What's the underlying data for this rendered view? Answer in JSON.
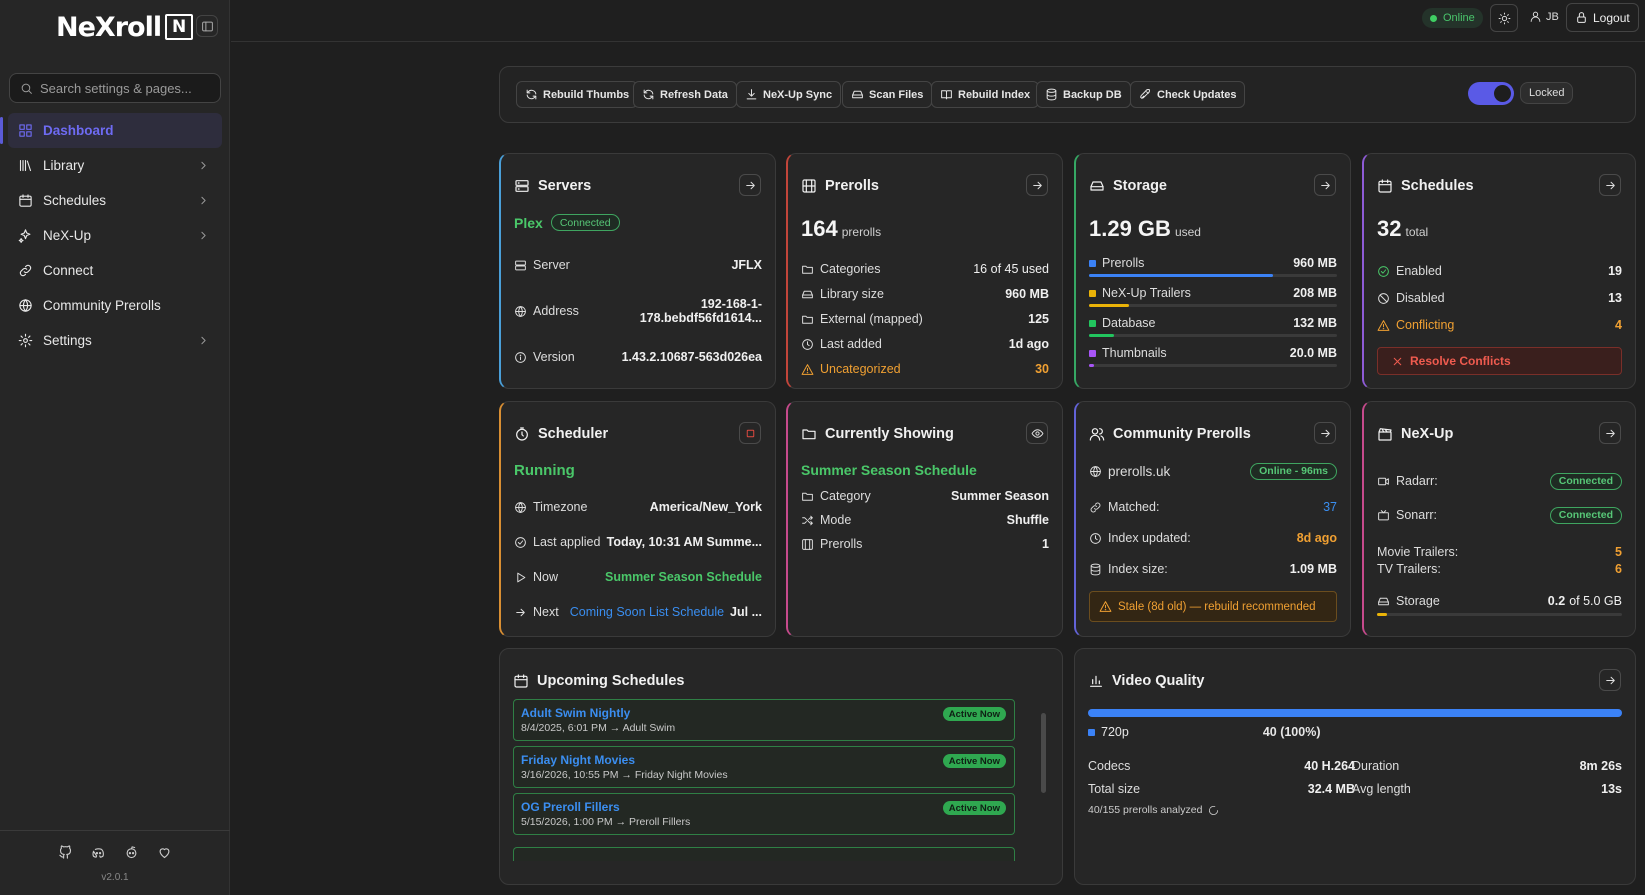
{
  "app": {
    "logo_text": "NeXroll",
    "logo_mark": "N",
    "version": "v2.0.1"
  },
  "search": {
    "placeholder": "Search settings & pages..."
  },
  "sidebar": {
    "items": [
      {
        "label": "Dashboard",
        "icon": "dashboard-icon",
        "active": true
      },
      {
        "label": "Library",
        "icon": "library-icon",
        "chevron": true
      },
      {
        "label": "Schedules",
        "icon": "calendar-icon",
        "chevron": true
      },
      {
        "label": "NeX-Up",
        "icon": "sparkles-icon",
        "chevron": true
      },
      {
        "label": "Connect",
        "icon": "link-icon"
      },
      {
        "label": "Community Prerolls",
        "icon": "globe-icon"
      },
      {
        "label": "Settings",
        "icon": "gear-icon",
        "chevron": true
      }
    ],
    "footer_icons": [
      "github-icon",
      "discord-icon",
      "reddit-icon",
      "heart-icon"
    ]
  },
  "topbar": {
    "status": "Online",
    "user": "JB",
    "logout": "Logout"
  },
  "toolbar": {
    "buttons": [
      "Rebuild Thumbs",
      "Refresh Data",
      "NeX-Up Sync",
      "Scan Files",
      "Rebuild Index",
      "Backup DB",
      "Check Updates"
    ],
    "lock_label": "Locked"
  },
  "servers": {
    "title": "Servers",
    "provider": "Plex",
    "status": "Connected",
    "server_label": "Server",
    "server_value": "JFLX",
    "address_label": "Address",
    "address_value": "192-168-1-178.bebdf56fd1614...",
    "version_label": "Version",
    "version_value": "1.43.2.10687-563d026ea"
  },
  "prerolls": {
    "title": "Prerolls",
    "count": "164",
    "count_unit": "prerolls",
    "rows": [
      {
        "label": "Categories",
        "value": "16 of 45 used"
      },
      {
        "label": "Library size",
        "value": "960 MB"
      },
      {
        "label": "External (mapped)",
        "value": "125"
      },
      {
        "label": "Last added",
        "value": "1d ago"
      },
      {
        "label": "Uncategorized",
        "value": "30"
      }
    ]
  },
  "storage": {
    "title": "Storage",
    "used": "1.29 GB",
    "used_unit": "used",
    "rows": [
      {
        "label": "Prerolls",
        "value": "960 MB",
        "color": "#3b82f6",
        "fraction": 0.74
      },
      {
        "label": "NeX-Up Trailers",
        "value": "208 MB",
        "color": "#eab308",
        "fraction": 0.16
      },
      {
        "label": "Database",
        "value": "132 MB",
        "color": "#22c55e",
        "fraction": 0.1
      },
      {
        "label": "Thumbnails",
        "value": "20.0 MB",
        "color": "#a855f7",
        "fraction": 0.02
      }
    ]
  },
  "schedules": {
    "title": "Schedules",
    "count": "32",
    "count_unit": "total",
    "enabled_label": "Enabled",
    "enabled_value": "19",
    "disabled_label": "Disabled",
    "disabled_value": "13",
    "conflicting_label": "Conflicting",
    "conflicting_value": "4",
    "resolve_label": "Resolve Conflicts"
  },
  "scheduler": {
    "title": "Scheduler",
    "status": "Running",
    "timezone_label": "Timezone",
    "timezone_value": "America/New_York",
    "last_label": "Last applied",
    "last_value": "Today, 10:31 AM Summe...",
    "now_label": "Now",
    "now_value": "Summer Season Schedule",
    "next_label": "Next",
    "next_value": "Coming Soon List Schedule",
    "next_suffix": "Jul ..."
  },
  "current": {
    "title": "Currently Showing",
    "schedule": "Summer Season Schedule",
    "category_label": "Category",
    "category_value": "Summer Season",
    "mode_label": "Mode",
    "mode_value": "Shuffle",
    "prerolls_label": "Prerolls",
    "prerolls_value": "1"
  },
  "community": {
    "title": "Community Prerolls",
    "site": "prerolls.uk",
    "status": "Online - 96ms",
    "matched_label": "Matched:",
    "matched_value": "37",
    "updated_label": "Index updated:",
    "updated_value": "8d ago",
    "size_label": "Index size:",
    "size_value": "1.09 MB",
    "warning": "Stale (8d old) — rebuild recommended"
  },
  "nexup": {
    "title": "NeX-Up",
    "radarr_label": "Radarr:",
    "radarr_status": "Connected",
    "sonarr_label": "Sonarr:",
    "sonarr_status": "Connected",
    "movie_label": "Movie Trailers:",
    "movie_value": "5",
    "tv_label": "TV Trailers:",
    "tv_value": "6",
    "storage_label": "Storage",
    "storage_used": "0.2",
    "storage_of": "of 5.0 GB",
    "storage_fraction": 0.04
  },
  "upcoming": {
    "title": "Upcoming Schedules",
    "items": [
      {
        "name": "Adult Swim Nightly",
        "sub": "8/4/2025, 6:01 PM → Adult Swim",
        "badge": "Active Now"
      },
      {
        "name": "Friday Night Movies",
        "sub": "3/16/2026, 10:55 PM → Friday Night Movies",
        "badge": "Active Now"
      },
      {
        "name": "OG Preroll Fillers",
        "sub": "5/15/2026, 1:00 PM → Preroll Fillers",
        "badge": "Active Now"
      }
    ]
  },
  "video": {
    "title": "Video Quality",
    "res_label": "720p",
    "res_value": "40 (100%)",
    "res_fraction": 1.0,
    "codecs_label": "Codecs",
    "codecs_value": "40 H.264",
    "duration_label": "Duration",
    "duration_value": "8m 26s",
    "total_label": "Total size",
    "total_value": "32.4 MB",
    "avg_label": "Avg length",
    "avg_value": "13s",
    "analyzed": "40/155 prerolls analyzed"
  }
}
